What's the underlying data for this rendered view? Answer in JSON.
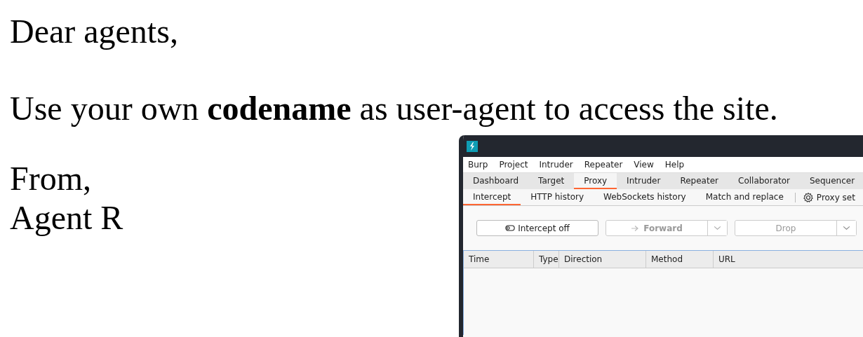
{
  "letter": {
    "greeting": "Dear agents,",
    "body": "Use your own **codename** as user-agent to access the site.",
    "closing": "From,",
    "signature": "Agent R"
  },
  "burp": {
    "menu": [
      "Burp",
      "Project",
      "Intruder",
      "Repeater",
      "View",
      "Help"
    ],
    "tabs": [
      {
        "label": "Dashboard",
        "selected": false
      },
      {
        "label": "Target",
        "selected": false
      },
      {
        "label": "Proxy",
        "selected": true
      },
      {
        "label": "Intruder",
        "selected": false
      },
      {
        "label": "Repeater",
        "selected": false
      },
      {
        "label": "Collaborator",
        "selected": false
      },
      {
        "label": "Sequencer",
        "selected": false
      }
    ],
    "subtabs": [
      {
        "label": "Intercept",
        "selected": true
      },
      {
        "label": "HTTP history",
        "selected": false
      },
      {
        "label": "WebSockets history",
        "selected": false
      },
      {
        "label": "Match and replace",
        "selected": false
      }
    ],
    "settings_link": "Proxy set",
    "intercept_button": "Intercept off",
    "forward_button": {
      "label": "Forward",
      "disabled": true
    },
    "drop_button": {
      "label": "Drop",
      "disabled": true
    },
    "columns": [
      "Time",
      "Type",
      "Direction",
      "Method",
      "URL"
    ]
  }
}
